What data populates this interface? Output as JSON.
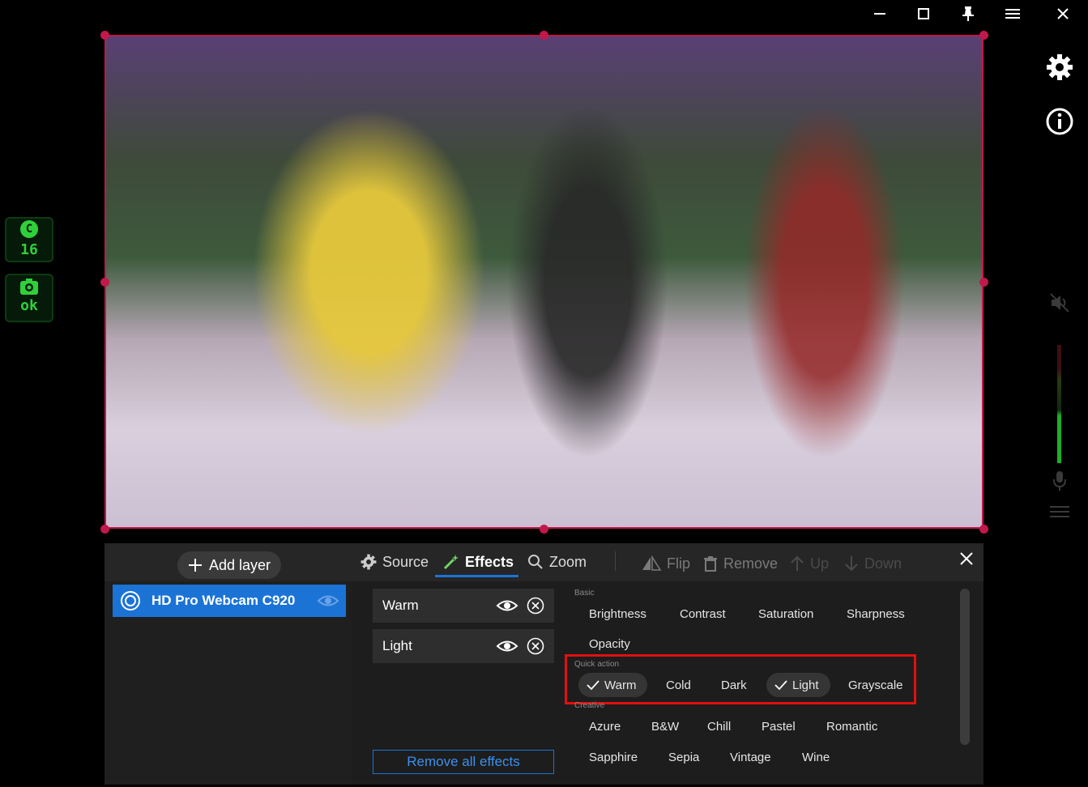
{
  "titlebar": {
    "buttons": [
      "minimize-icon",
      "maximize-icon",
      "pin-icon",
      "menu-icon",
      "close-icon"
    ]
  },
  "badges": [
    {
      "icon": "C",
      "value": "16"
    },
    {
      "icon": "camera-icon",
      "value": "ok"
    }
  ],
  "toolbar": {
    "add_layer": "Add layer",
    "tabs": {
      "source": "Source",
      "effects": "Effects",
      "zoom": "Zoom",
      "flip": "Flip",
      "remove": "Remove",
      "up": "Up",
      "down": "Down"
    }
  },
  "layers": [
    {
      "name": "HD Pro Webcam C920"
    }
  ],
  "active_effects": [
    {
      "name": "Warm"
    },
    {
      "name": "Light"
    }
  ],
  "remove_all": "Remove all effects",
  "sections": {
    "basic": {
      "title": "Basic",
      "items": [
        "Brightness",
        "Contrast",
        "Saturation",
        "Sharpness",
        "Opacity"
      ]
    },
    "quick": {
      "title": "Quick action",
      "items": [
        "Warm",
        "Cold",
        "Dark",
        "Light",
        "Grayscale"
      ],
      "selected": [
        "Warm",
        "Light"
      ]
    },
    "creative": {
      "title": "Creative",
      "items": [
        "Azure",
        "B&W",
        "Chill",
        "Pastel",
        "Romantic",
        "Sapphire",
        "Sepia",
        "Vintage",
        "Wine"
      ]
    }
  },
  "colors": {
    "accent": "#1b73d6",
    "selection_border": "#c2184b",
    "highlight_box": "#e01010",
    "badge_green": "#2fd13a"
  },
  "audio_level": 0.45
}
